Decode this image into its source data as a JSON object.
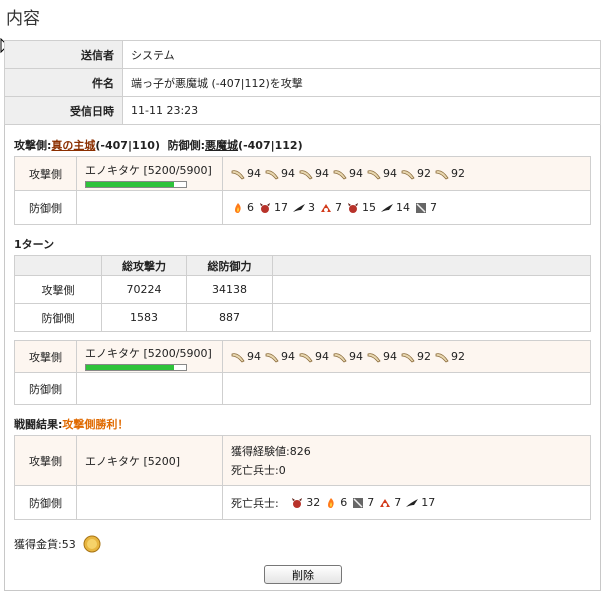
{
  "title": "内容",
  "header": {
    "rows": [
      {
        "key": "送信者",
        "value": "システム"
      },
      {
        "key": "件名",
        "value": "端っ子が悪魔城 (-407|112)を攻撃"
      },
      {
        "key": "受信日時",
        "value": "11-11 23:23"
      }
    ]
  },
  "battle": {
    "attacker_label": "攻撃側:",
    "attacker_name": "真の主城",
    "attacker_coords": "(-407|110)",
    "defender_label": "防御側:",
    "defender_name": "悪魔城",
    "defender_coords": "(-407|112)"
  },
  "side": {
    "attack": "攻撃側",
    "defense": "防御側"
  },
  "hero": {
    "name": "エノキタケ",
    "hp": "[5200/5900]",
    "hp_fraction": 0.88,
    "hero_result": "エノキタケ [5200]"
  },
  "attack_units": [
    "94",
    "94",
    "94",
    "94",
    "94",
    "92",
    "92"
  ],
  "defense_units": [
    {
      "icon": "fire-icon",
      "count": "6"
    },
    {
      "icon": "demon-icon",
      "count": "17"
    },
    {
      "icon": "bat-icon",
      "count": "3"
    },
    {
      "icon": "imp-icon",
      "count": "7"
    },
    {
      "icon": "demon-icon",
      "count": "15"
    },
    {
      "icon": "bat-icon",
      "count": "14"
    },
    {
      "icon": "golem-icon",
      "count": "7"
    }
  ],
  "turn": {
    "label": "1ターン",
    "col_attack": "総攻撃力",
    "col_defense": "総防御力",
    "rows": [
      {
        "side": "攻撃側",
        "atk": "70224",
        "def": "34138"
      },
      {
        "side": "防御側",
        "atk": "1583",
        "def": "887"
      }
    ]
  },
  "result": {
    "label": "戦闘結果:",
    "outcome": "攻撃側勝利！",
    "exp": "獲得経験値:826",
    "att_dead": "死亡兵士:0",
    "def_dead_label": "死亡兵士:",
    "def_dead": [
      {
        "icon": "demon-icon",
        "count": "32"
      },
      {
        "icon": "fire-icon",
        "count": "6"
      },
      {
        "icon": "golem-icon",
        "count": "7"
      },
      {
        "icon": "imp-icon",
        "count": "7"
      },
      {
        "icon": "bat-icon",
        "count": "17"
      }
    ]
  },
  "gold": "獲得金貨:53",
  "delete_button": "削除",
  "colors": {
    "accent": "#e06a00",
    "hp": "#2ec33a"
  }
}
